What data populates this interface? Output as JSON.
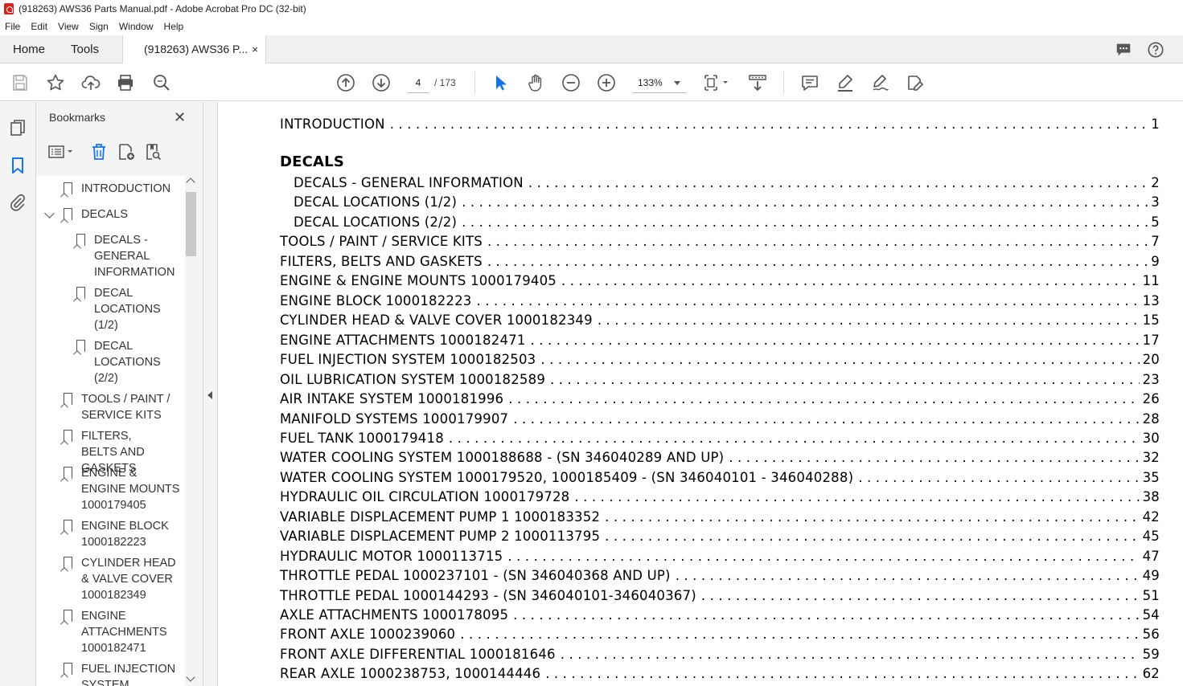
{
  "window": {
    "title": "(918263) AWS36 Parts Manual.pdf - Adobe Acrobat Pro DC (32-bit)"
  },
  "menu": [
    "File",
    "Edit",
    "View",
    "Sign",
    "Window",
    "Help"
  ],
  "tabs": {
    "home": "Home",
    "tools": "Tools",
    "doc": "(918263) AWS36 P...",
    "close": "×"
  },
  "toolbar": {
    "page_current": "4",
    "page_total": "/ 173",
    "zoom": "133%"
  },
  "panel": {
    "title": "Bookmarks",
    "close": "✕",
    "bookmarks": [
      {
        "label": "INTRODUCTION"
      },
      {
        "label": "DECALS"
      },
      {
        "label": "DECALS - GENERAL INFORMATION"
      },
      {
        "label": "DECAL LOCATIONS (1/2)"
      },
      {
        "label": "DECAL LOCATIONS (2/2)"
      },
      {
        "label": "TOOLS / PAINT / SERVICE KITS"
      },
      {
        "label": "FILTERS, BELTS AND GASKETS"
      },
      {
        "label": "ENGINE & ENGINE MOUNTS 1000179405"
      },
      {
        "label": "ENGINE BLOCK 1000182223"
      },
      {
        "label": "CYLINDER HEAD & VALVE COVER 1000182349"
      },
      {
        "label": "ENGINE ATTACHMENTS 1000182471"
      },
      {
        "label": "FUEL INJECTION SYSTEM"
      }
    ]
  },
  "toc": [
    {
      "title": "INTRODUCTION",
      "page": "1"
    },
    {
      "title": "DECALS",
      "page": ""
    },
    {
      "title": "DECALS - GENERAL INFORMATION",
      "page": "2"
    },
    {
      "title": "DECAL LOCATIONS (1/2)",
      "page": "3"
    },
    {
      "title": "DECAL LOCATIONS (2/2)",
      "page": "5"
    },
    {
      "title": "TOOLS / PAINT / SERVICE KITS",
      "page": "7"
    },
    {
      "title": "FILTERS, BELTS AND GASKETS",
      "page": "9"
    },
    {
      "title": "ENGINE & ENGINE MOUNTS 1000179405",
      "page": "11"
    },
    {
      "title": "ENGINE BLOCK 1000182223",
      "page": "13"
    },
    {
      "title": "CYLINDER HEAD & VALVE COVER 1000182349",
      "page": "15"
    },
    {
      "title": "ENGINE ATTACHMENTS 1000182471",
      "page": "17"
    },
    {
      "title": "FUEL INJECTION SYSTEM 1000182503",
      "page": "20"
    },
    {
      "title": "OIL LUBRICATION SYSTEM 1000182589",
      "page": "23"
    },
    {
      "title": "AIR INTAKE SYSTEM 1000181996",
      "page": "26"
    },
    {
      "title": "MANIFOLD SYSTEMS 1000179907",
      "page": "28"
    },
    {
      "title": "FUEL TANK 1000179418",
      "page": "30"
    },
    {
      "title": "WATER COOLING SYSTEM 1000188688 - (SN 346040289 AND UP)",
      "page": "32"
    },
    {
      "title": "WATER COOLING SYSTEM 1000179520, 1000185409 - (SN 346040101 - 346040288)",
      "page": "35"
    },
    {
      "title": "HYDRAULIC OIL CIRCULATION 1000179728",
      "page": "38"
    },
    {
      "title": "VARIABLE DISPLACEMENT PUMP 1 1000183352",
      "page": "42"
    },
    {
      "title": "VARIABLE DISPLACEMENT PUMP 2 1000113795",
      "page": "45"
    },
    {
      "title": "HYDRAULIC MOTOR 1000113715",
      "page": "47"
    },
    {
      "title": "THROTTLE PEDAL 1000237101 - (SN 346040368 AND UP)",
      "page": "49"
    },
    {
      "title": "THROTTLE PEDAL 1000144293 - (SN 346040101-346040367)",
      "page": "51"
    },
    {
      "title": "AXLE ATTACHMENTS 1000178095",
      "page": "54"
    },
    {
      "title": "FRONT AXLE 1000239060",
      "page": "56"
    },
    {
      "title": "FRONT AXLE DIFFERENTIAL 1000181646",
      "page": "59"
    },
    {
      "title": "REAR AXLE 1000238753, 1000144446",
      "page": "62"
    }
  ],
  "colors": {
    "accent": "#1473e6",
    "pdf_red": "#d9221c",
    "chrome_bg": "#f0f0f0"
  },
  "icons": [
    "pdf-icon",
    "comment-icon",
    "help-icon",
    "save-icon",
    "star-icon",
    "upload-icon",
    "print-icon",
    "zoom-search-icon",
    "page-up-icon",
    "page-down-icon",
    "select-arrow-icon",
    "hand-icon",
    "zoom-out-icon",
    "zoom-in-icon",
    "page-fit-icon",
    "scroll-mode-icon",
    "comment-note-icon",
    "highlight-icon",
    "sign-icon",
    "edit-pdf-icon",
    "pages-icon",
    "bookmark-icon",
    "attachment-icon",
    "options-icon",
    "delete-bookmark-icon",
    "new-bookmark-icon",
    "bookmark-search-icon"
  ]
}
